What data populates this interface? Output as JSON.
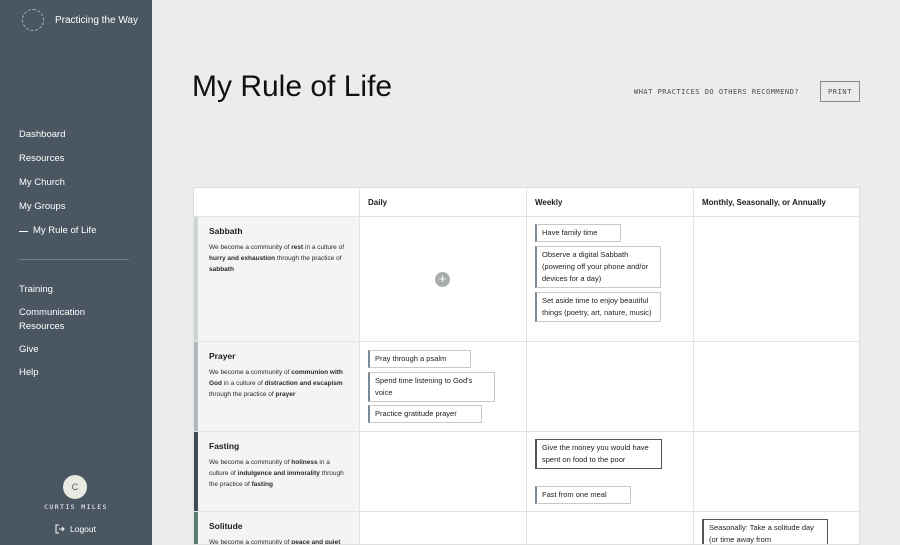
{
  "brand": {
    "name": "Practicing the Way",
    "logo_icon": "circle-logo-icon"
  },
  "sidebar": {
    "primary": [
      {
        "label": "Dashboard",
        "active": false
      },
      {
        "label": "Resources",
        "active": false
      },
      {
        "label": "My Church",
        "active": false
      },
      {
        "label": "My Groups",
        "active": false
      },
      {
        "label": "My Rule of Life",
        "active": true
      }
    ],
    "secondary": [
      {
        "label": "Training"
      },
      {
        "label": "Communication Resources"
      },
      {
        "label": "Give"
      },
      {
        "label": "Help"
      }
    ],
    "user": {
      "initial": "C",
      "name": "CURTIS MILES"
    },
    "logout_label": "Logout"
  },
  "page": {
    "title": "My Rule of Life",
    "recommend_link": "WHAT PRACTICES DO OTHERS RECOMMEND?",
    "print_label": "PRINT"
  },
  "table": {
    "columns": [
      "",
      "Daily",
      "Weekly",
      "Monthly, Seasonally, or Annually"
    ],
    "rows": [
      {
        "name": "Sabbath",
        "accent": "#cfd6cf",
        "desc": [
          "We become a community of ",
          "rest",
          " in a culture of ",
          "hurry and exhaustion",
          " through the practice of ",
          "sabbath"
        ],
        "daily": [],
        "weekly": [
          "Have family time",
          "Observe a digital Sabbath (powering off your phone and/or devices for a day)",
          "Set aside time to enjoy beautiful things (poetry, art, nature, music)"
        ],
        "monthly": []
      },
      {
        "name": "Prayer",
        "accent": "#b3b8be",
        "desc": [
          "We become a community of ",
          "communion with God",
          " in a culture of ",
          "distraction and escapism",
          " through the practice of ",
          "prayer"
        ],
        "daily": [
          "Pray through a psalm",
          "Spend time listening to God's voice",
          "Practice gratitude prayer"
        ],
        "weekly": [],
        "monthly": []
      },
      {
        "name": "Fasting",
        "accent": "#3f4a53",
        "desc": [
          "We become a community of ",
          "holiness",
          " in a culture of ",
          "indulgence and immorality",
          " through the practice of ",
          "fasting"
        ],
        "daily": [],
        "weekly": [
          "Give the money you would have spent on food to the poor",
          "Fast from one meal"
        ],
        "monthly": []
      },
      {
        "name": "Solitude",
        "accent": "#5f7a6e",
        "desc": [
          "We become a community of ",
          "peace and quiet"
        ],
        "daily": [],
        "weekly": [],
        "monthly": [
          "Seasonally: Take a solitude day (or time away from"
        ]
      }
    ]
  },
  "colors": {
    "sidebar": "#4a5661",
    "background": "#ececec"
  }
}
